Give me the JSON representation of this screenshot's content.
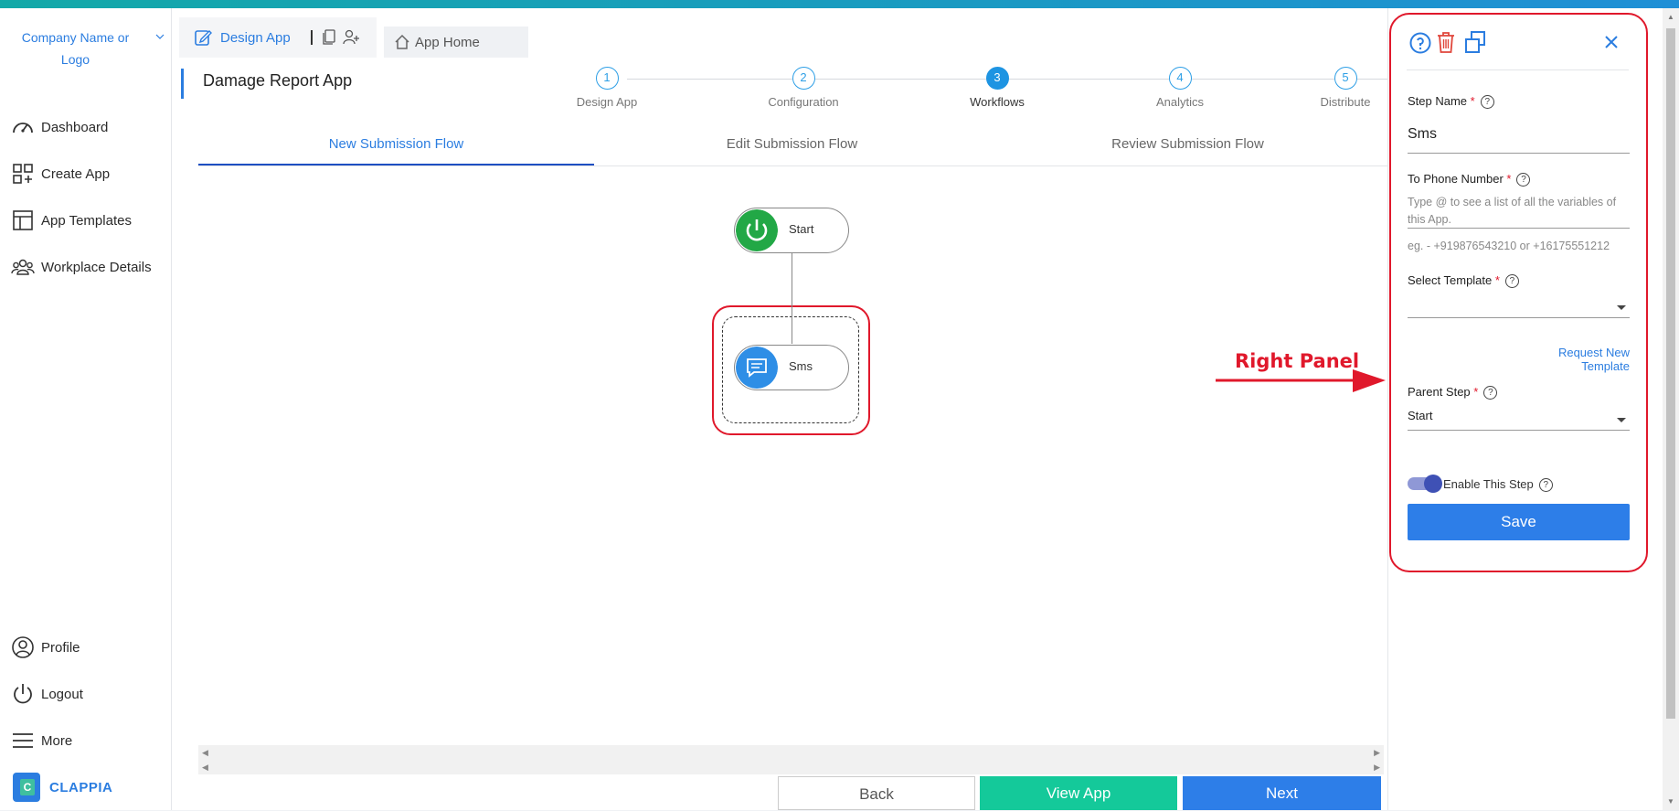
{
  "sidebar": {
    "company": "Company Name or Logo",
    "items": [
      {
        "label": "Dashboard",
        "icon": "dashboard-icon"
      },
      {
        "label": "Create App",
        "icon": "create-app-icon"
      },
      {
        "label": "App Templates",
        "icon": "templates-icon"
      },
      {
        "label": "Workplace Details",
        "icon": "workplace-icon"
      }
    ],
    "bottom_items": [
      {
        "label": "Profile",
        "icon": "profile-icon"
      },
      {
        "label": "Logout",
        "icon": "logout-icon"
      },
      {
        "label": "More",
        "icon": "menu-icon"
      }
    ],
    "brand": "CLAPPIA"
  },
  "tabs": {
    "design": "Design App",
    "home": "App Home"
  },
  "app": {
    "title": "Damage Report App"
  },
  "stepper": {
    "active": 3,
    "steps": [
      {
        "num": "1",
        "label": "Design App"
      },
      {
        "num": "2",
        "label": "Configuration"
      },
      {
        "num": "3",
        "label": "Workflows"
      },
      {
        "num": "4",
        "label": "Analytics"
      },
      {
        "num": "5",
        "label": "Distribute"
      }
    ]
  },
  "flow_tabs": [
    "New Submission Flow",
    "Edit Submission Flow",
    "Review Submission Flow"
  ],
  "active_flow_tab": 0,
  "nodes": {
    "start": "Start",
    "sms": "Sms"
  },
  "footer": {
    "back": "Back",
    "view_app": "View App",
    "next": "Next"
  },
  "annotation": "Right Panel",
  "right_panel": {
    "step_name_label": "Step Name",
    "step_name_value": "Sms",
    "phone_label": "To Phone Number",
    "phone_placeholder": "Type @ to see a list of all the variables of this App.",
    "phone_hint": "eg. - +919876543210 or +16175551212",
    "template_label": "Select Template",
    "template_value": "",
    "request_link": "Request New Template",
    "parent_label": "Parent Step",
    "parent_value": "Start",
    "enable_label": "Enable This Step",
    "enabled": true,
    "save": "Save"
  },
  "colors": {
    "accent": "#2b7de0",
    "start_node": "#22a846",
    "sms_node": "#2e8ee6",
    "view_app": "#14c99a",
    "annotation": "#e0182b"
  }
}
